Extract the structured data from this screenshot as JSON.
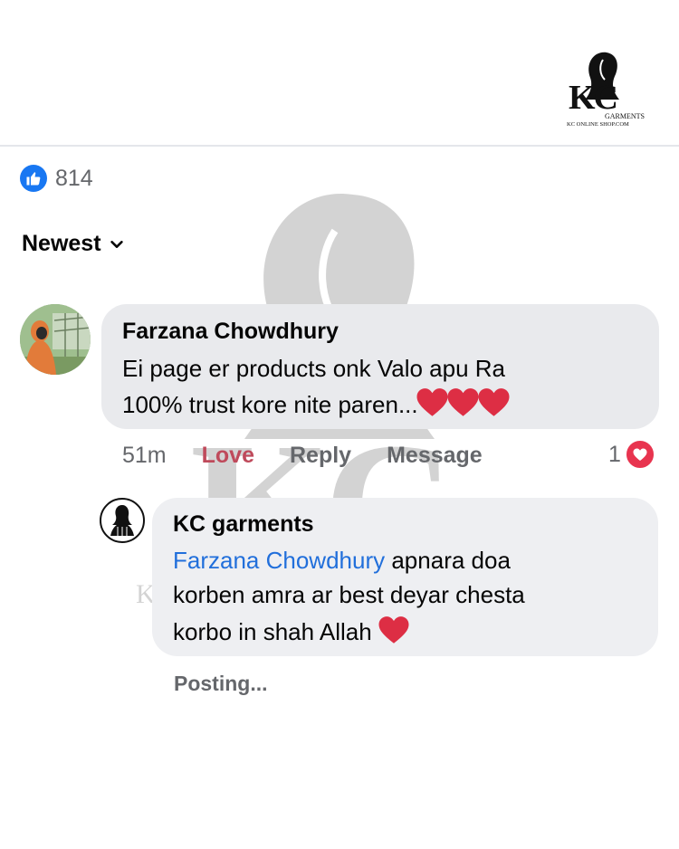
{
  "brand": {
    "logo_letters": "KC",
    "logo_garments": "GARMENTS",
    "logo_site": "KC ONLINE SHOP.COM"
  },
  "post": {
    "reaction_icon": "like-icon",
    "reaction_count": "814",
    "sort_label": "Newest",
    "sort_icon": "chevron-down-icon"
  },
  "comment": {
    "author": "Farzana Chowdhury",
    "text_line1": "Ei page er products onk Valo apu Ra",
    "text_line2": "100% trust kore nite paren...",
    "emoji": "heart-emoji",
    "time": "51m",
    "love_label": "Love",
    "reply_label": "Reply",
    "message_label": "Message",
    "love_count": "1",
    "love_color": "#e8344f"
  },
  "reply": {
    "author": "KC garments",
    "mention": "Farzana Chowdhury",
    "text_line1_rest": " apnara doa",
    "text_line2": "korben amra ar best deyar chesta",
    "text_line3": "korbo in shah Allah",
    "status": "Posting..."
  },
  "colors": {
    "like_blue": "#1877f2",
    "mention_blue": "#216fdb",
    "love_text": "#bf4a5b",
    "bubble_bg": "#e9eaed",
    "meta_gray": "#65676b"
  }
}
